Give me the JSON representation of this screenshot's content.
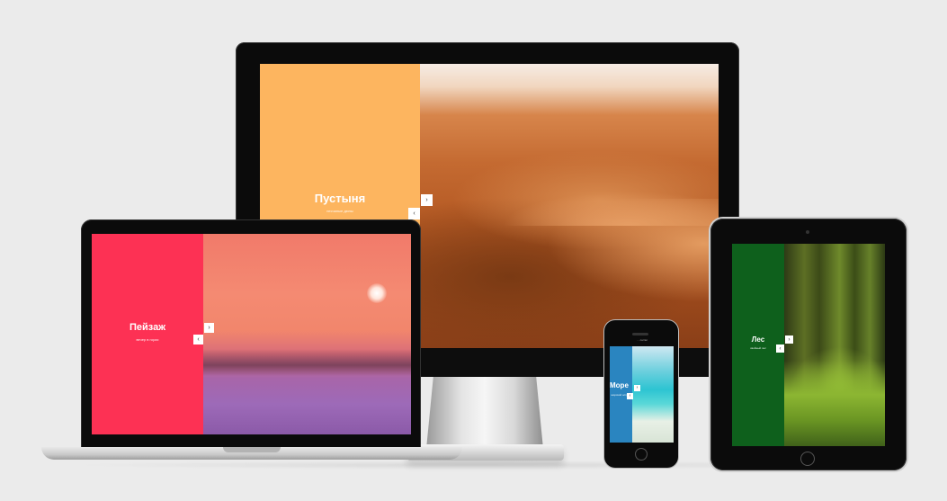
{
  "slides": {
    "desktop": {
      "title": "Пустыня",
      "subtitle": "песчаные дюны",
      "next": "›",
      "prev": "‹"
    },
    "laptop": {
      "title": "Пейзаж",
      "subtitle": "вечер в горах",
      "next": "›",
      "prev": "‹"
    },
    "tablet": {
      "title": "Лес",
      "subtitle": "хвойный лес",
      "next": "›",
      "prev": "‹"
    },
    "phone": {
      "title": "Море",
      "subtitle": "морской остров",
      "next": "›",
      "prev": "‹",
      "status": "··· carrier"
    }
  },
  "colors": {
    "desert_panel": "#fdb55f",
    "landscape_panel": "#fd3154",
    "forest_panel": "#0e601c",
    "sea_panel": "#2a85c0"
  }
}
